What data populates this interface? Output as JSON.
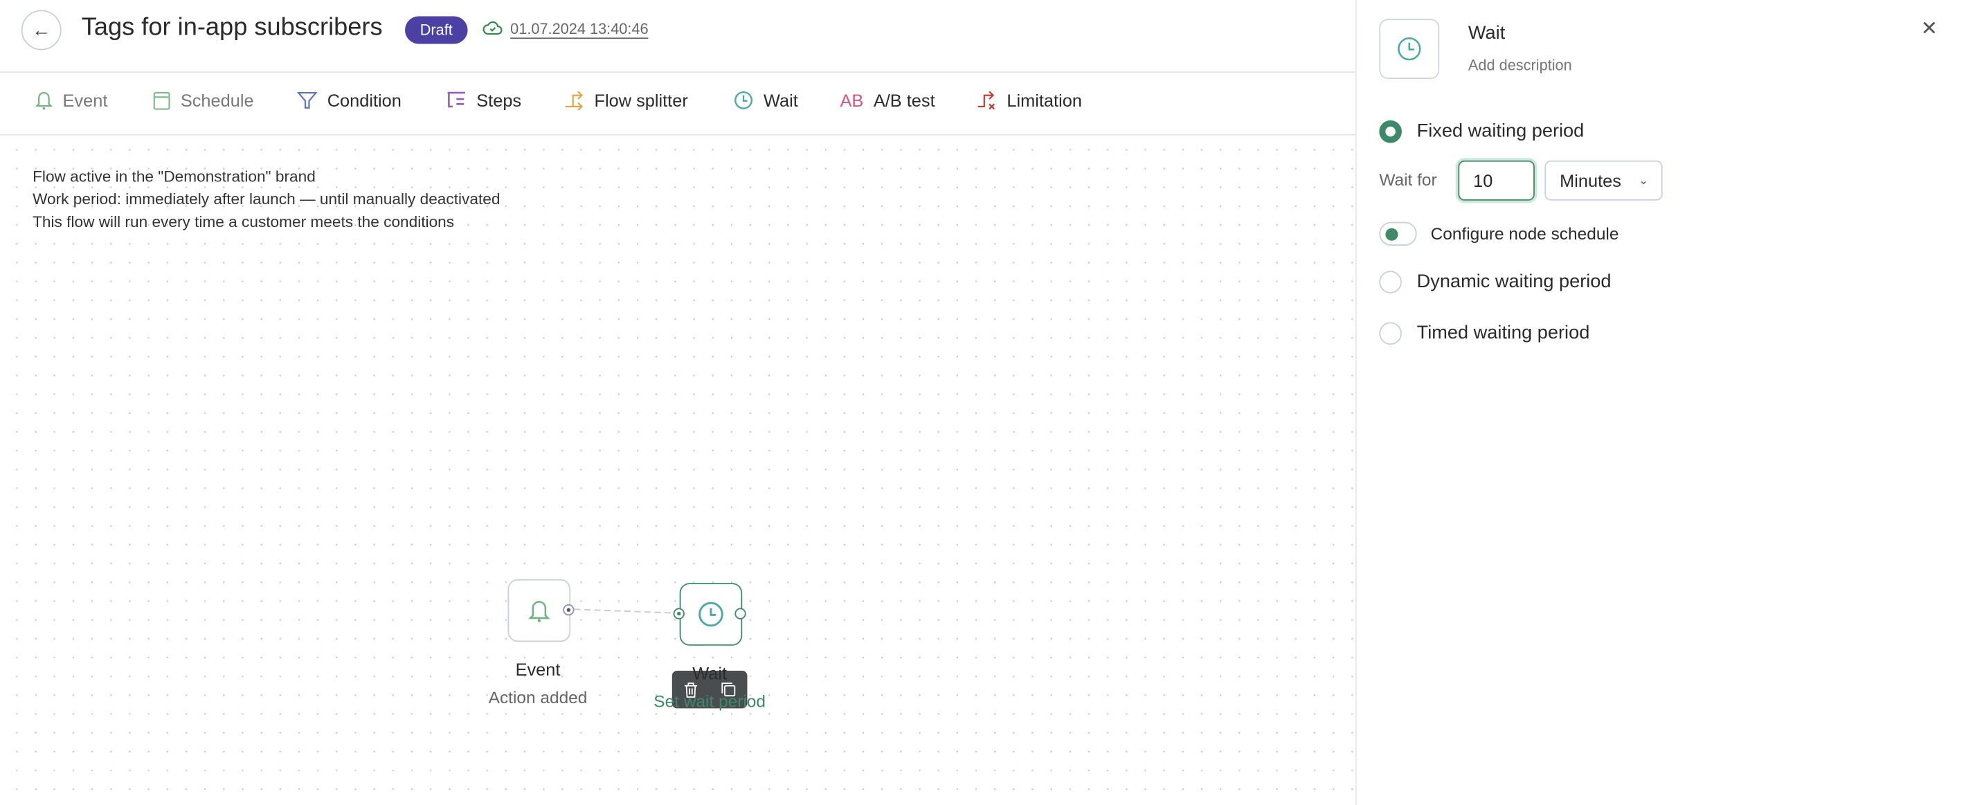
{
  "header": {
    "back_icon": "arrow-left-icon",
    "title": "Tags for in-app subscribers",
    "status_badge": "Draft",
    "save_icon": "cloud-check-icon",
    "saved_at": "01.07.2024 13:40:46"
  },
  "toolbar": {
    "items": [
      {
        "label": "Event",
        "icon": "bell-icon",
        "color": "#6fb47f"
      },
      {
        "label": "Schedule",
        "icon": "calendar-icon",
        "color": "#7dbb8a"
      },
      {
        "label": "Condition",
        "icon": "funnel-icon",
        "color": "#5a72c9"
      },
      {
        "label": "Steps",
        "icon": "steps-icon",
        "color": "#9a55b8"
      },
      {
        "label": "Flow splitter",
        "icon": "split-icon",
        "color": "#e3a23c"
      },
      {
        "label": "Wait",
        "icon": "clock-icon",
        "color": "#4aa8a8"
      },
      {
        "label": "A/B test",
        "icon": "ab-icon",
        "color": "#d7557f"
      },
      {
        "label": "Limitation",
        "icon": "limit-icon",
        "color": "#c0392b"
      }
    ]
  },
  "canvas": {
    "info": [
      "Flow active in the \"Demonstration\" brand",
      "Work period: immediately after launch — until manually deactivated",
      "This flow will run every time a customer meets the conditions"
    ],
    "nodes": [
      {
        "title": "Event",
        "subtitle": "Action added",
        "icon": "bell-icon"
      },
      {
        "title": "Wait",
        "subtitle": "Set wait period",
        "icon": "clock-icon"
      }
    ],
    "node_actions": [
      "trash-icon",
      "copy-icon"
    ]
  },
  "panel": {
    "title": "Wait",
    "description_placeholder": "Add description",
    "close_icon": "close-icon",
    "options": [
      {
        "label": "Fixed waiting period",
        "selected": true
      },
      {
        "label": "Dynamic waiting period",
        "selected": false
      },
      {
        "label": "Timed waiting period",
        "selected": false
      }
    ],
    "wait_for_label": "Wait for",
    "wait_value": "10",
    "unit": "Minutes",
    "schedule_toggle_label": "Configure node schedule",
    "schedule_toggle_on": true
  },
  "colors": {
    "accent": "#3d8a68",
    "badge": "#4b40a4",
    "clock": "#4aa8a8"
  }
}
